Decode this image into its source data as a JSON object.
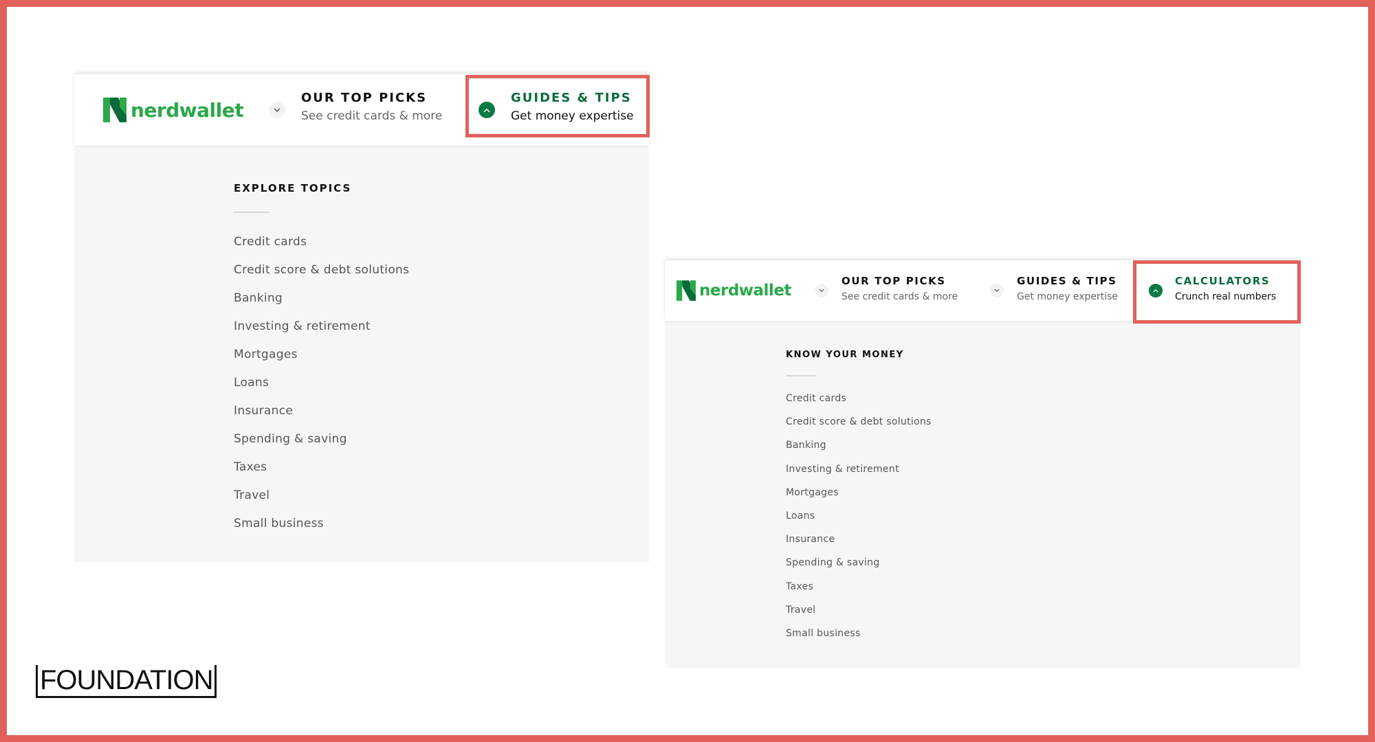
{
  "brand": {
    "logo_text": "nerdwallet",
    "logo_green": "#2aa84a",
    "logo_dark": "#0a6b3a"
  },
  "accent": {
    "highlight_border": "#e0625a",
    "active_green": "#0a6b3a"
  },
  "footer": {
    "foundation_label": "FOUNDATION"
  },
  "left_panel": {
    "nav": [
      {
        "title": "OUR TOP PICKS",
        "subtitle": "See credit cards & more",
        "state": "collapsed",
        "icon": "chevron-down-icon"
      },
      {
        "title": "GUIDES & TIPS",
        "subtitle": "Get money expertise",
        "state": "expanded",
        "icon": "chevron-up-icon"
      }
    ],
    "section_title": "EXPLORE TOPICS",
    "topics": [
      "Credit cards",
      "Credit score & debt solutions",
      "Banking",
      "Investing & retirement",
      "Mortgages",
      "Loans",
      "Insurance",
      "Spending & saving",
      "Taxes",
      "Travel",
      "Small business"
    ]
  },
  "right_panel": {
    "nav": [
      {
        "title": "OUR TOP PICKS",
        "subtitle": "See credit cards & more",
        "state": "collapsed",
        "icon": "chevron-down-icon"
      },
      {
        "title": "GUIDES & TIPS",
        "subtitle": "Get money expertise",
        "state": "collapsed",
        "icon": "chevron-down-icon"
      },
      {
        "title": "CALCULATORS",
        "subtitle": "Crunch real numbers",
        "state": "expanded",
        "icon": "chevron-up-icon"
      }
    ],
    "section_title": "KNOW YOUR MONEY",
    "topics": [
      "Credit cards",
      "Credit score & debt solutions",
      "Banking",
      "Investing & retirement",
      "Mortgages",
      "Loans",
      "Insurance",
      "Spending & saving",
      "Taxes",
      "Travel",
      "Small business"
    ]
  }
}
